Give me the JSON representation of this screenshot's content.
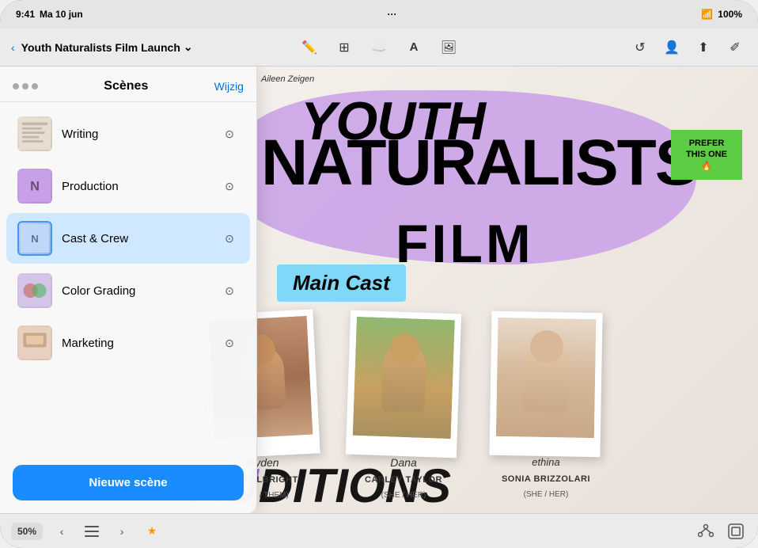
{
  "status": {
    "time": "9:41",
    "day": "Ma 10 jun",
    "wifi_icon": "wifi",
    "battery": "100%",
    "dots": "···"
  },
  "toolbar": {
    "back_label": "‹",
    "project_title": "Youth Naturalists Film Launch",
    "dropdown_icon": "⌄",
    "icon_pencil": "✏",
    "icon_grid": "⊞",
    "icon_cloud": "☁",
    "icon_text": "A",
    "icon_image": "⊡",
    "icon_history": "↺",
    "icon_share": "⬆",
    "icon_edit": "✐",
    "icon_people": "👤",
    "dots": "···"
  },
  "canvas": {
    "film_title_youth": "YOUTH",
    "film_title_naturalists": "NATURALISTS",
    "film_title_film": "FILM",
    "main_cast_label": "Main Cast",
    "cast": [
      {
        "name": "TY FULLBRIGHT",
        "pronoun": "(THEY / THEM)",
        "color": "#c8956a"
      },
      {
        "name": "CARLEY TAYLOR",
        "pronoun": "(SHE / HER)",
        "color": "#a8b870"
      },
      {
        "name": "SONIA BRIZZOLARI",
        "pronoun": "(SHE / HER)",
        "color": "#c0a890"
      }
    ],
    "sticky_note": "PREFER\nTHIS ONE\n🔥",
    "handwritten_name": "Aileen Zeigen",
    "audititions_partial": "DITIONS"
  },
  "scenes_panel": {
    "dots_label": "···",
    "title": "Scènes",
    "edit_label": "Wijzig",
    "scenes": [
      {
        "id": "writing",
        "name": "Writing",
        "active": false
      },
      {
        "id": "production",
        "name": "Production",
        "active": false
      },
      {
        "id": "cast-crew",
        "name": "Cast & Crew",
        "active": true
      },
      {
        "id": "color-grading",
        "name": "Color Grading",
        "active": false
      },
      {
        "id": "marketing",
        "name": "Marketing",
        "active": false
      }
    ],
    "new_scene_label": "Nieuwe scène"
  },
  "bottom_bar": {
    "zoom": "50%",
    "nav_back": "‹",
    "nav_list": "☰",
    "nav_forward": "›",
    "nav_star": "★",
    "icon_share": "⬆",
    "icon_layout": "⊡"
  }
}
